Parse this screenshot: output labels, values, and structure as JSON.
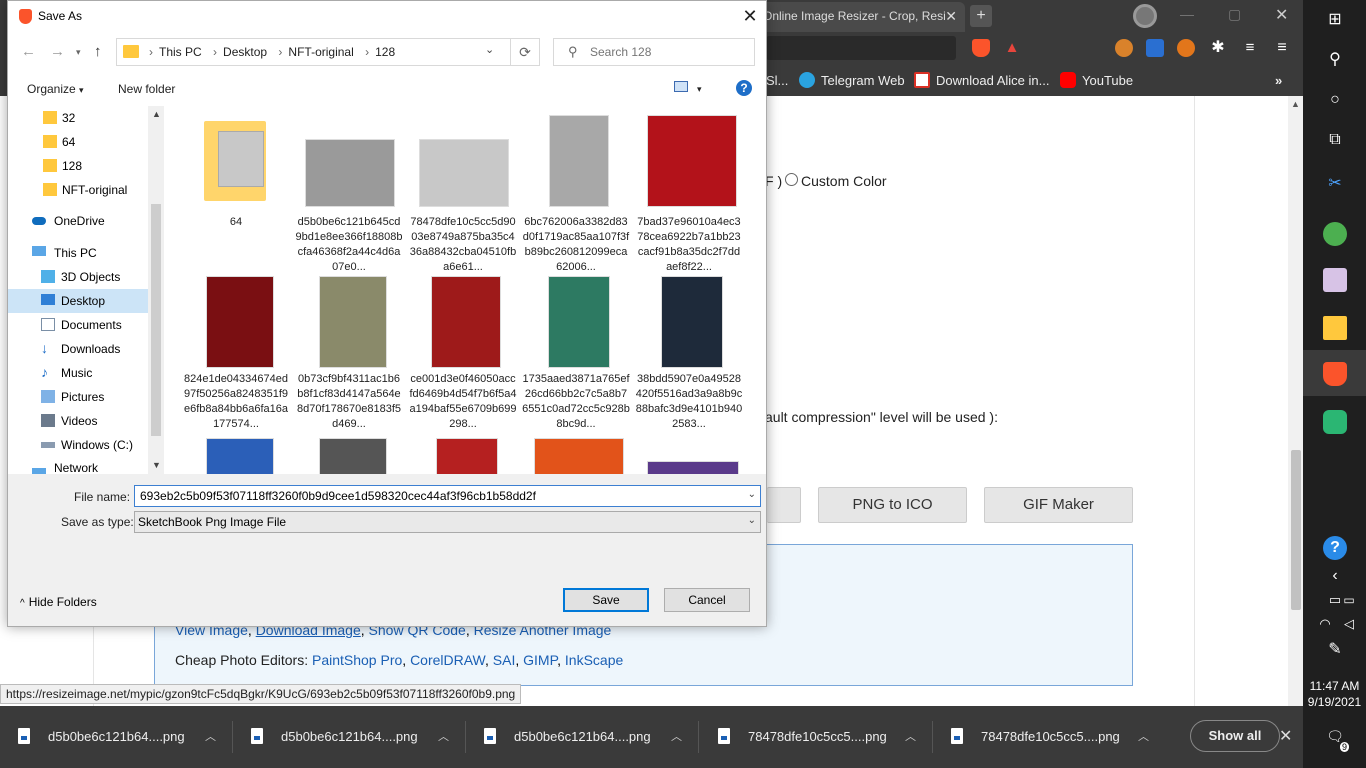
{
  "browser": {
    "tab_title": "Online Image Resizer - Crop, Resi",
    "bookmarks": [
      "Sl...",
      "Telegram Web",
      "Download Alice in...",
      "YouTube"
    ],
    "page_text_custom_color": "Custom Color",
    "page_text_paren": "F )",
    "page_text_compression": "ault compression\" level will be used ):",
    "page_buttons": [
      "PNG to ICO",
      "GIF Maker"
    ],
    "links_line": [
      "View Image",
      "Download Image",
      "Show QR Code",
      "Resize Another Image"
    ],
    "editors_label": "Cheap Photo Editors:",
    "editors": [
      "PaintShop Pro",
      "CorelDRAW",
      "SAI",
      "GIMP",
      "InkScape"
    ],
    "status_url": "https://resizeimage.net/mypic/gzon9tcFc5dqBgkr/K9UcG/693eb2c5b09f53f07118ff3260f0b9.png"
  },
  "downloads": {
    "items": [
      "d5b0be6c121b64....png",
      "d5b0be6c121b64....png",
      "d5b0be6c121b64....png",
      "78478dfe10c5cc5....png",
      "78478dfe10c5cc5....png"
    ],
    "show_all": "Show all"
  },
  "taskbar": {
    "time": "11:47 AM",
    "date": "9/19/2021",
    "notifications": "9"
  },
  "dialog": {
    "title": "Save As",
    "breadcrumbs": [
      "This PC",
      "Desktop",
      "NFT-original",
      "128"
    ],
    "search_placeholder": "Search 128",
    "organize": "Organize",
    "new_folder": "New folder",
    "nav_items": [
      {
        "label": "32",
        "icon": "folder-icon"
      },
      {
        "label": "64",
        "icon": "folder-icon"
      },
      {
        "label": "128",
        "icon": "folder-icon"
      },
      {
        "label": "NFT-original",
        "icon": "folder-icon"
      },
      {
        "label": "OneDrive",
        "icon": "onedrive-icon"
      },
      {
        "label": "This PC",
        "icon": "pc-icon"
      },
      {
        "label": "3D Objects",
        "icon": "3d-objects-icon"
      },
      {
        "label": "Desktop",
        "icon": "desktop-icon"
      },
      {
        "label": "Documents",
        "icon": "documents-icon"
      },
      {
        "label": "Downloads",
        "icon": "downloads-icon"
      },
      {
        "label": "Music",
        "icon": "music-icon"
      },
      {
        "label": "Pictures",
        "icon": "pictures-icon"
      },
      {
        "label": "Videos",
        "icon": "videos-icon"
      },
      {
        "label": "Windows (C:)",
        "icon": "drive-icon"
      },
      {
        "label": "Network",
        "icon": "network-icon"
      }
    ],
    "files": [
      {
        "name": "64",
        "color": "#ffd56b"
      },
      {
        "name": "d5b0be6c121b645cd9bd1e8ee366f18808bcfa46368f2a44c4d6a07e0...",
        "color": "#9a9a9a"
      },
      {
        "name": "78478dfe10c5cc5d9003e8749a875ba35c436a88432cba04510fba6e61...",
        "color": "#c8c8c8"
      },
      {
        "name": "6bc762006a3382d83d0f1719ac85aa107f3fb89bc260812099eca62006...",
        "color": "#a8a8a8"
      },
      {
        "name": "7bad37e96010a4ec378cea6922b7a1bb23cacf91b8a35dc2f7ddaef8f22...",
        "color": "#b3121a"
      },
      {
        "name": "824e1de04334674ed97f50256a8248351f9e6fb8a84bb6a6fa16a177574...",
        "color": "#7a0f12"
      },
      {
        "name": "0b73cf9bf4311ac1b6b8f1cf83d4147a564e8d70f178670e8183f5d469...",
        "color": "#8a8a6a"
      },
      {
        "name": "ce001d3e0f46050accfd6469b4d54f7b6f5a4a194baf55e6709b699298...",
        "color": "#9e1a1a"
      },
      {
        "name": "1735aaed3871a765ef26cd66bb2c7c5a8b76551c0ad72cc5c928b8bc9d...",
        "color": "#2d7a62"
      },
      {
        "name": "38bdd5907e0a49528420f5516ad3a9a8b9c88bafc3d9e4101b9402583...",
        "color": "#1e2a3a"
      }
    ],
    "file_name_label": "File name:",
    "file_name_value": "693eb2c5b09f53f07118ff3260f0b9d9cee1d598320cec44af3f96cb1b58dd2f",
    "save_type_label": "Save as type:",
    "save_type_value": "SketchBook Png Image File",
    "hide_folders": "Hide Folders",
    "save": "Save",
    "cancel": "Cancel"
  }
}
